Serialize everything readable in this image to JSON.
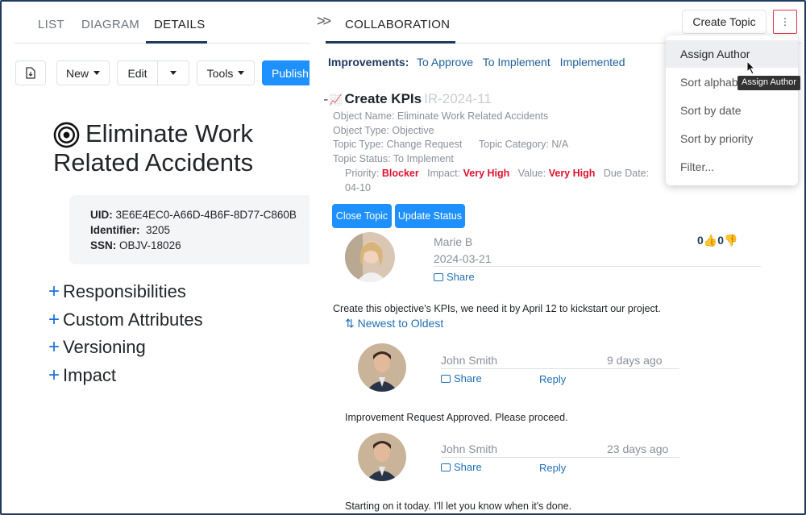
{
  "left_tabs": [
    "LIST",
    "DIAGRAM",
    "DETAILS"
  ],
  "toolbar": {
    "new": "New",
    "edit": "Edit",
    "tools": "Tools",
    "publish": "Publish"
  },
  "object": {
    "title_line1": "Eliminate Work",
    "title_line2": "Related Accidents",
    "uid_label": "UID:",
    "uid_value": "3E6E4EC0-A66D-4B6F-8D77-C860B",
    "identifier_label": "Identifier:",
    "identifier_value": "3205",
    "ssn_label": "SSN:",
    "ssn_value": "OBJV-18026"
  },
  "sections": [
    "Responsibilities",
    "Custom Attributes",
    "Versioning",
    "Impact"
  ],
  "collaboration": {
    "tab": "COLLABORATION",
    "create_topic": "Create Topic",
    "kebab": "⋮",
    "improvements_label": "Improvements:",
    "filters": [
      "To Approve",
      "To Implement",
      "Implemented"
    ]
  },
  "topic": {
    "title": "Create KPIs",
    "id": "IR-2024-11",
    "object_name": "Object Name: Eliminate Work Related Accidents",
    "object_type": "Object Type: Objective",
    "topic_type": "Topic Type: Change Request",
    "topic_category": "Topic Category: N/A",
    "topic_status": "Topic Status: To Implement",
    "priority_label": "Priority:",
    "priority_value": "Blocker",
    "impact_label": "Impact:",
    "impact_value": "Very High",
    "value_label": "Value:",
    "value_value": "Very High",
    "due_label": "Due Date:",
    "due_tail": "04-10",
    "close_btn": "Close Topic",
    "update_btn": "Update Status"
  },
  "post": {
    "author": "Marie B",
    "date": "2024-03-21",
    "share": "Share",
    "up_votes": "0",
    "down_votes": "0",
    "text": "Create this objective's KPIs, we need it by April 12 to kickstart our project.",
    "sort": "Newest to Oldest"
  },
  "replies": [
    {
      "author": "John Smith",
      "ago": "9 days ago",
      "share": "Share",
      "reply": "Reply",
      "text": "Improvement Request Approved. Please proceed."
    },
    {
      "author": "John Smith",
      "ago": "23 days ago",
      "share": "Share",
      "reply": "Reply",
      "text": "Starting on it today. I'll let you know when it's done."
    }
  ],
  "menu": {
    "items": [
      "Assign Author",
      "Sort alphab",
      "Sort by date",
      "Sort by priority",
      "Filter..."
    ],
    "tooltip": "Assign Author"
  },
  "colors": {
    "accent": "#1e90ff",
    "navy": "#1f3a5f",
    "red": "#e0102e",
    "link": "#1f6fb5"
  }
}
